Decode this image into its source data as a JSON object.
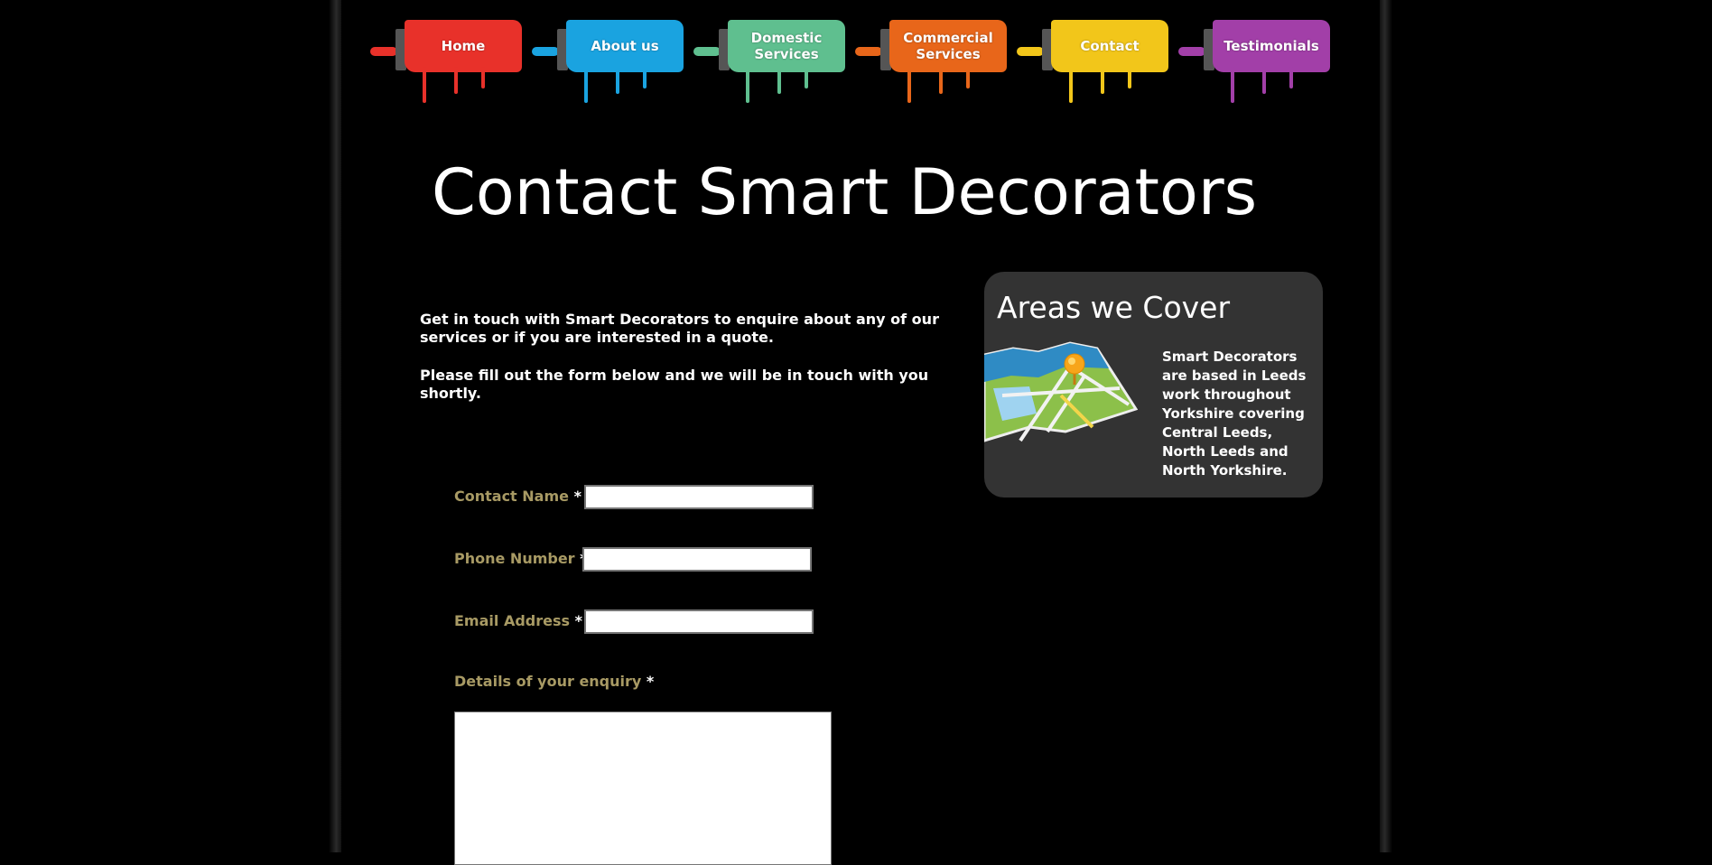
{
  "nav": {
    "items": [
      {
        "label": "Home",
        "color": "#e8312a"
      },
      {
        "label": "About us",
        "color": "#1aa3e0"
      },
      {
        "label": "Domestic Services",
        "color": "#5fbf8f"
      },
      {
        "label": "Commercial Services",
        "color": "#e8661a"
      },
      {
        "label": "Contact",
        "color": "#f2c61a"
      },
      {
        "label": "Testimonials",
        "color": "#a23fa8"
      }
    ]
  },
  "page": {
    "title": "Contact Smart Decorators"
  },
  "intro": {
    "p1": "Get in touch with Smart Decorators to enquire about any of our services or if you are interested in a quote.",
    "p2": "Please fill out the form below and we will be in touch with you shortly."
  },
  "form": {
    "required_mark": "*",
    "name_label": "Contact Name",
    "name_value": "",
    "phone_label": "Phone Number",
    "phone_value": "",
    "email_label": "Email Address",
    "email_value": "",
    "details_label": "Details of your enquiry",
    "details_value": ""
  },
  "sidebar": {
    "title": "Areas we Cover",
    "text": "Smart Decorators are based in Leeds work throughout Yorkshire covering Central Leeds, North Leeds and North Yorkshire.",
    "image_icon": "map-pin-icon"
  }
}
